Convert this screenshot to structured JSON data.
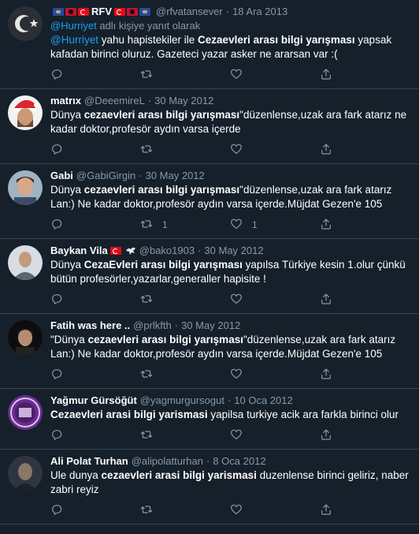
{
  "tweets": [
    {
      "name": "RFV",
      "flags_before": [
        "ks",
        "al",
        "tr"
      ],
      "flags_after": [
        "tr",
        "al",
        "ks"
      ],
      "handle": "@rfvatansever",
      "date": "18 Ara 2013",
      "reply_to": "@Hurriyet",
      "reply_suffix": " adlı kişiye yanıt olarak",
      "parts": [
        {
          "t": "@Hurriyet",
          "link": true
        },
        {
          "t": " yahu hapistekiler ile "
        },
        {
          "t": "Cezaevleri arası bilgi yarışması",
          "b": true
        },
        {
          "t": " yapsak kafadan birinci oluruz. Gazeteci yazar asker ne ararsan var :("
        }
      ],
      "retweets": "",
      "likes": ""
    },
    {
      "name": "matrıx",
      "handle": "@DeeemireL",
      "date": "30 May 2012",
      "parts": [
        {
          "t": "Dünya "
        },
        {
          "t": "cezaevleri arası bilgi yarışması",
          "b": true
        },
        {
          "t": "\"düzenlense,uzak ara fark atarız ne kadar doktor,profesör aydın varsa içerde"
        }
      ],
      "retweets": "",
      "likes": ""
    },
    {
      "name": "Gabi",
      "handle": "@GabiGirgin",
      "date": "30 May 2012",
      "parts": [
        {
          "t": "Dünya "
        },
        {
          "t": "cezaevleri arası bilgi yarışması",
          "b": true
        },
        {
          "t": "\"düzenlense,uzak ara fark atarız Lan:) Ne kadar doktor,profesör aydın varsa içerde.Müjdat Gezen'e 105"
        }
      ],
      "retweets": "1",
      "likes": "1"
    },
    {
      "name": "Baykan Vila",
      "flags_after": [
        "tr"
      ],
      "eagle": true,
      "handle": "@bako1903",
      "date": "30 May 2012",
      "parts": [
        {
          "t": "Dünya "
        },
        {
          "t": "CezaEvleri arası bilgi yarışması",
          "b": true
        },
        {
          "t": " yapılsa Türkiye kesin 1.olur çünkü bütün profesörler,yazarlar,generaller hapisite !"
        }
      ],
      "retweets": "",
      "likes": ""
    },
    {
      "name": "Fatih was here ..",
      "handle": "@prlkfth",
      "date": "30 May 2012",
      "parts": [
        {
          "t": "\"Dünya "
        },
        {
          "t": "cezaevleri arası bilgi yarışması",
          "b": true
        },
        {
          "t": "\"düzenlense,uzak ara fark atarız Lan:) Ne kadar doktor,profesör aydın varsa içerde.Müjdat Gezen'e 105"
        }
      ],
      "retweets": "",
      "likes": ""
    },
    {
      "name": "Yağmur Gürsöğüt",
      "handle": "@yagmurgursogut",
      "date": "10 Oca 2012",
      "parts": [
        {
          "t": "Cezaevleri arasi bilgi yarismasi",
          "b": true
        },
        {
          "t": " yapilsa turkiye acik ara farkla birinci olur"
        }
      ],
      "retweets": "",
      "likes": ""
    },
    {
      "name": "Ali Polat Turhan",
      "handle": "@alipolatturhan",
      "date": "8 Oca 2012",
      "parts": [
        {
          "t": "Ule dunya "
        },
        {
          "t": "cezaevleri arasi bilgi yarismasi",
          "b": true
        },
        {
          "t": " duzenlense birinci geliriz, naber zabri reyiz"
        }
      ],
      "retweets": "",
      "likes": ""
    }
  ],
  "icons": {
    "reply": "reply-icon",
    "retweet": "retweet-icon",
    "like": "heart-icon",
    "share": "share-icon"
  },
  "colors": {
    "background": "#15202b",
    "divider": "#38444d",
    "secondary_text": "#8899a6",
    "link": "#1da1f2"
  }
}
